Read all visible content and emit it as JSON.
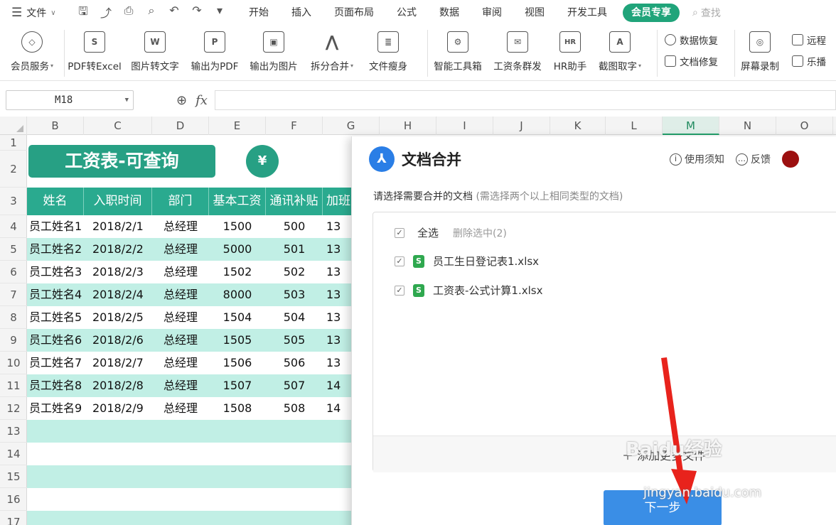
{
  "menubar": {
    "file_label": "文件",
    "tabs": [
      "开始",
      "插入",
      "页面布局",
      "公式",
      "数据",
      "审阅",
      "视图",
      "开发工具"
    ],
    "vip_tab": "会员专享",
    "search_label": "查找"
  },
  "ribbon": {
    "member_service": "会员服务",
    "items": [
      {
        "label": "PDF转Excel",
        "icon": "S"
      },
      {
        "label": "图片转文字",
        "icon": "W"
      },
      {
        "label": "输出为PDF",
        "icon": "P"
      },
      {
        "label": "输出为图片",
        "icon": "▣"
      },
      {
        "label": "拆分合并",
        "icon": "⋀"
      },
      {
        "label": "文件瘦身",
        "icon": "≣"
      }
    ],
    "items2": [
      {
        "label": "智能工具箱",
        "icon": "⚙"
      },
      {
        "label": "工资条群发",
        "icon": "✉"
      },
      {
        "label": "HR助手",
        "icon": "HR"
      },
      {
        "label": "截图取字",
        "icon": "A"
      }
    ],
    "data_recover": "数据恢复",
    "doc_repair": "文档修复",
    "screen_record": "屏幕录制",
    "remote": "远程",
    "lebo": "乐播"
  },
  "formula_bar": {
    "name_box": "M18",
    "fx_label": "fx"
  },
  "columns": [
    "B",
    "C",
    "D",
    "E",
    "F",
    "G",
    "H",
    "I",
    "J",
    "K",
    "L",
    "M",
    "N",
    "O"
  ],
  "rows": [
    "1",
    "2",
    "3",
    "4",
    "5",
    "6",
    "7",
    "8",
    "9",
    "10",
    "11",
    "12",
    "13",
    "14",
    "15",
    "16",
    "17"
  ],
  "sheet": {
    "title": "工资表-可查询",
    "moneybag_symbol": "¥",
    "headers": [
      "姓名",
      "入职时间",
      "部门",
      "基本工资",
      "通讯补贴",
      "加班"
    ],
    "data": [
      [
        "员工姓名1",
        "2018/2/1",
        "总经理",
        "1500",
        "500",
        "13"
      ],
      [
        "员工姓名2",
        "2018/2/2",
        "总经理",
        "5000",
        "501",
        "13"
      ],
      [
        "员工姓名3",
        "2018/2/3",
        "总经理",
        "1502",
        "502",
        "13"
      ],
      [
        "员工姓名4",
        "2018/2/4",
        "总经理",
        "8000",
        "503",
        "13"
      ],
      [
        "员工姓名5",
        "2018/2/5",
        "总经理",
        "1504",
        "504",
        "13"
      ],
      [
        "员工姓名6",
        "2018/2/6",
        "总经理",
        "1505",
        "505",
        "13"
      ],
      [
        "员工姓名7",
        "2018/2/7",
        "总经理",
        "1506",
        "506",
        "13"
      ],
      [
        "员工姓名8",
        "2018/2/8",
        "总经理",
        "1507",
        "507",
        "14"
      ],
      [
        "员工姓名9",
        "2018/2/9",
        "总经理",
        "1508",
        "508",
        "14"
      ]
    ]
  },
  "dialog": {
    "title": "文档合并",
    "usage_notes": "使用须知",
    "feedback": "反馈",
    "prompt": "请选择需要合并的文档",
    "prompt_hint": "(需选择两个以上相同类型的文档)",
    "select_all": "全选",
    "delete_selected": "删除选中(2)",
    "files": [
      "员工生日登记表1.xlsx",
      "工资表-公式计算1.xlsx"
    ],
    "add_more": "添加更多文件",
    "next": "下一步"
  },
  "watermark": {
    "brand": "Baidu经验",
    "site": "jingyan.baidu.com"
  },
  "colors": {
    "accent_green": "#27a084",
    "header_teal": "#2aaa8f",
    "row_alt": "#c1efe5",
    "primary_blue": "#3a8ee6",
    "arrow_red": "#e8231c"
  }
}
